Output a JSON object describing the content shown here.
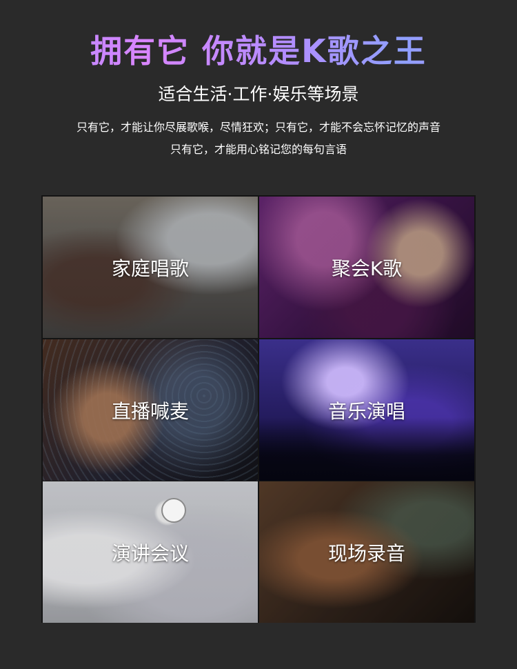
{
  "header": {
    "headline": "拥有它 你就是K歌之王",
    "subtitle": "适合生活·工作·娱乐等场景",
    "description_line1": "只有它，才能让你尽展歌喉，尽情狂欢；只有它，才能不会忘怀记忆的声音",
    "description_line2": "只有它，才能用心铭记您的每句言语"
  },
  "scenes": [
    {
      "label": "家庭唱歌"
    },
    {
      "label": "聚会K歌"
    },
    {
      "label": "直播喊麦"
    },
    {
      "label": "音乐演唱"
    },
    {
      "label": "演讲会议"
    },
    {
      "label": "现场录音"
    }
  ]
}
